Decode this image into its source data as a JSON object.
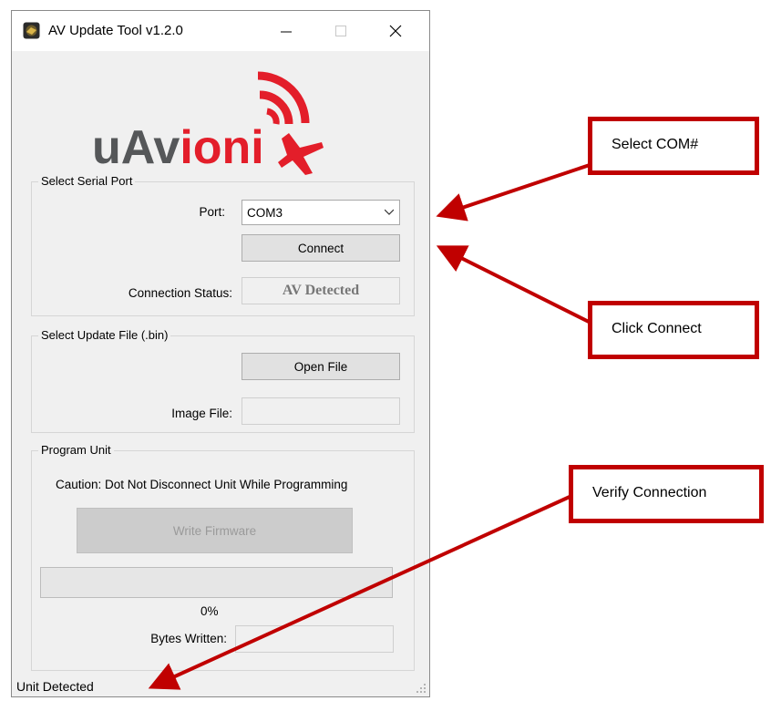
{
  "window": {
    "title": "AV Update Tool v1.2.0",
    "controls": {
      "minimize": "–",
      "maximize": "☐",
      "close": "✕"
    }
  },
  "logo": {
    "text_dark": "uAvioni",
    "text_dark_part": "uAv",
    "text_red_part": "ioni",
    "icon": "plane-with-signal-waves-icon",
    "colors": {
      "dark": "#555759",
      "red": "#e31e2a"
    }
  },
  "serial_port": {
    "group_title": "Select Serial Port",
    "port_label": "Port:",
    "port_value": "COM3",
    "connect_label": "Connect",
    "status_label": "Connection Status:",
    "status_value": "AV Detected"
  },
  "update_file": {
    "group_title": "Select Update File (.bin)",
    "open_file_label": "Open File",
    "image_file_label": "Image File:",
    "image_file_value": ""
  },
  "program_unit": {
    "group_title": "Program Unit",
    "caution": "Caution: Dot Not Disconnect Unit While Programming",
    "write_label": "Write Firmware",
    "progress_percent": 0,
    "progress_text": "0%",
    "bytes_label": "Bytes Written:",
    "bytes_value": ""
  },
  "statusbar": {
    "text": "Unit Detected"
  },
  "callouts": {
    "select_com": "Select COM#",
    "click_connect": "Click Connect",
    "verify": "Verify Connection",
    "color": "#c00000"
  }
}
